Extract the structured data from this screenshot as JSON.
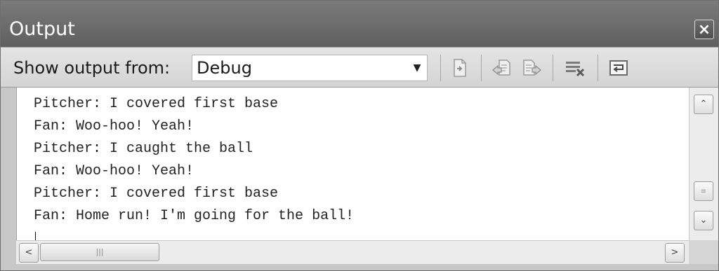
{
  "window": {
    "title": "Output",
    "close_glyph": "×"
  },
  "toolbar": {
    "show_output_label": "Show output from:",
    "source_value": "Debug",
    "buttons": [
      {
        "icon": "go-to-source-icon"
      },
      {
        "icon": "previous-message-icon"
      },
      {
        "icon": "next-message-icon"
      },
      {
        "icon": "clear-all-icon"
      },
      {
        "icon": "word-wrap-icon"
      }
    ]
  },
  "output": {
    "lines": [
      "Pitcher: I covered first base",
      "Fan: Woo-hoo! Yeah!",
      "Pitcher: I caught the ball",
      "Fan: Woo-hoo! Yeah!",
      "Pitcher: I covered first base",
      "Fan: Home run! I'm going for the ball!"
    ]
  },
  "scrollbars": {
    "up_glyph": "⌃",
    "down_glyph": "⌄",
    "left_glyph": "<",
    "right_glyph": ">"
  }
}
